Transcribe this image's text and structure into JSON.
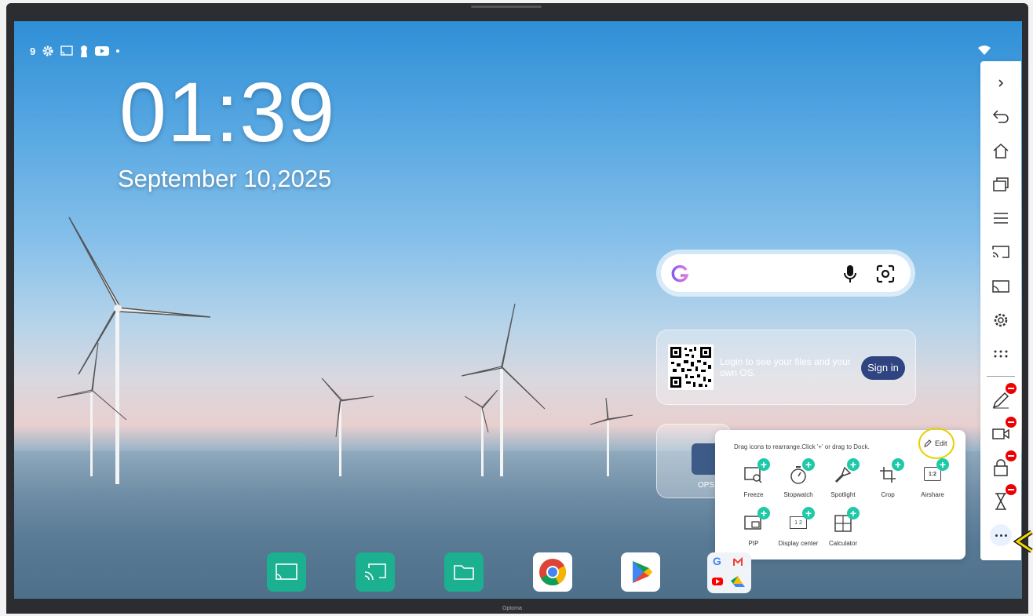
{
  "status_bar": {
    "left_text": "9",
    "icons": [
      "gear-icon",
      "cast-icon",
      "keyhole-icon",
      "youtube-icon",
      "dot-icon"
    ],
    "right_icon": "wifi-icon"
  },
  "clock": {
    "time": "01:39",
    "date": "September 10,2025"
  },
  "search_widget": {
    "logo": "google-g-icon",
    "mic": "mic-icon",
    "lens": "lens-icon"
  },
  "login_widget": {
    "text": "Login to see your files and your own OS.",
    "button": "Sign in"
  },
  "ops_widget": {
    "label": "OPS"
  },
  "tools_panel": {
    "hint": "Drag icons to rearrange.Click '+' or drag to Dock.",
    "edit_label": "Edit",
    "tools": [
      {
        "label": "Freeze",
        "icon": "freeze-icon"
      },
      {
        "label": "Stopwatch",
        "icon": "stopwatch-icon"
      },
      {
        "label": "Spotlight",
        "icon": "spotlight-icon"
      },
      {
        "label": "Crop",
        "icon": "crop-icon"
      },
      {
        "label": "Airshare",
        "icon": "airshare-icon"
      },
      {
        "label": "PIP",
        "icon": "pip-icon"
      },
      {
        "label": "Display center",
        "icon": "display-center-icon"
      },
      {
        "label": "Calculator",
        "icon": "calculator-icon"
      }
    ],
    "airshare_text": "1:2",
    "display_center_text": "1 2"
  },
  "sidebar": {
    "items": [
      "collapse-icon",
      "back-icon",
      "home-icon",
      "windows-icon",
      "menu-icon",
      "cast-screen-icon",
      "screen-share-icon",
      "settings-icon",
      "apps-grid-icon"
    ],
    "dock_items": [
      "pen-icon",
      "video-icon",
      "lock-icon",
      "hourglass-icon"
    ],
    "more": "more-icon"
  },
  "dock": {
    "apps": [
      "whiteboard-app",
      "screen-cast-app",
      "file-manager-app",
      "chrome-app",
      "play-store-app",
      "google-folder-app"
    ]
  },
  "brand": "Optoma"
}
